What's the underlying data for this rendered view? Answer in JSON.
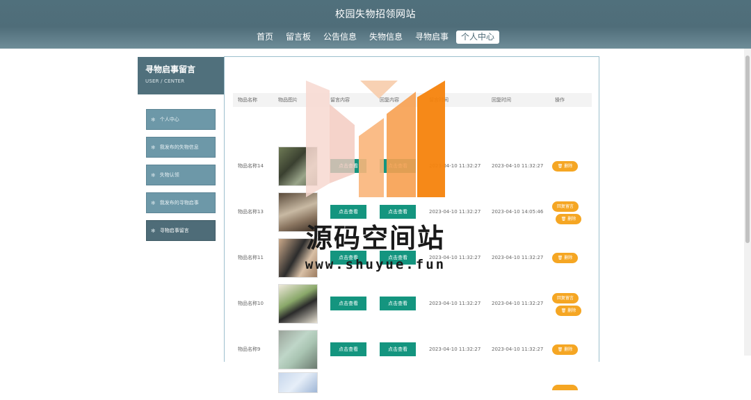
{
  "header": {
    "site_title": "校园失物招领网站",
    "nav": [
      "首页",
      "留言板",
      "公告信息",
      "失物信息",
      "寻物启事",
      "个人中心"
    ],
    "active_nav": "个人中心"
  },
  "sidebar": {
    "title": "寻物启事留言",
    "subtitle": "USER / CENTER",
    "items": [
      "个人中心",
      "我发布的失物信息",
      "失物认领",
      "我发布的寻物启事",
      "寻物启事留言"
    ],
    "active_index": 4
  },
  "table": {
    "headers": [
      "物品名称",
      "物品图片",
      "留言内容",
      "回复内容",
      "留言时间",
      "回复时间",
      "操作"
    ],
    "view_label": "点击查看",
    "delete_label": "删除",
    "reply_label": "回复留言",
    "rows": [
      {
        "name": "物品名称14",
        "msg_time": "2023-04-10 11:32:27",
        "reply_time": "2023-04-10 11:32:27",
        "has_reply_btn": false
      },
      {
        "name": "物品名称13",
        "msg_time": "2023-04-10 11:32:27",
        "reply_time": "2023-04-10 14:05:46",
        "has_reply_btn": true
      },
      {
        "name": "物品名称11",
        "msg_time": "2023-04-10 11:32:27",
        "reply_time": "2023-04-10 11:32:27",
        "has_reply_btn": false
      },
      {
        "name": "物品名称10",
        "msg_time": "2023-04-10 11:32:27",
        "reply_time": "2023-04-10 11:32:27",
        "has_reply_btn": true
      },
      {
        "name": "物品名称9",
        "msg_time": "2023-04-10 11:32:27",
        "reply_time": "2023-04-10 11:32:27",
        "has_reply_btn": false
      }
    ]
  },
  "watermark": {
    "text": "源码空间站",
    "url": "www.shuyue.fun"
  },
  "colors": {
    "header_bg": "#50707c",
    "menu_bg": "#6d98a8",
    "menu_active_bg": "#4e6c78",
    "view_button": "#14957f",
    "delete_button": "#f5a623"
  }
}
